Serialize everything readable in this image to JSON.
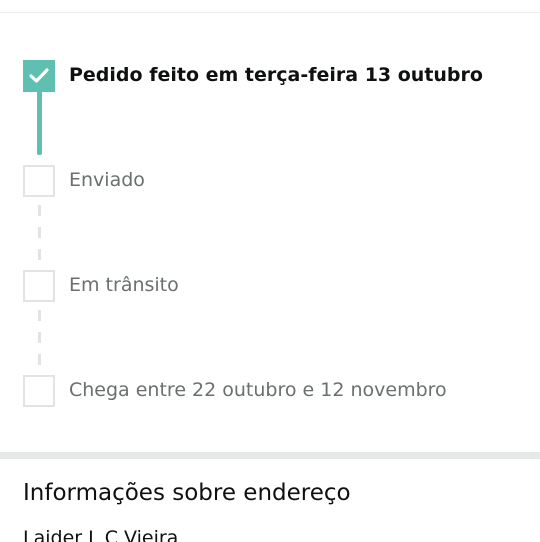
{
  "tracking": {
    "steps": [
      {
        "label": "Pedido feito em terça-feira 13 outubro",
        "status": "done"
      },
      {
        "label": "Enviado",
        "status": "pending"
      },
      {
        "label": "Em trânsito",
        "status": "pending"
      },
      {
        "label": "Chega entre 22 outubro e 12 novembro",
        "status": "pending"
      }
    ]
  },
  "address": {
    "title": "Informações sobre endereço",
    "name": "Laider L C Vieira"
  },
  "colors": {
    "accent": "#5fc0b1",
    "pending_border": "#e3e3e3",
    "text_primary": "#0f1111",
    "text_secondary": "#6a6f6f"
  },
  "icons": {
    "done_step": "checkmark-icon"
  }
}
